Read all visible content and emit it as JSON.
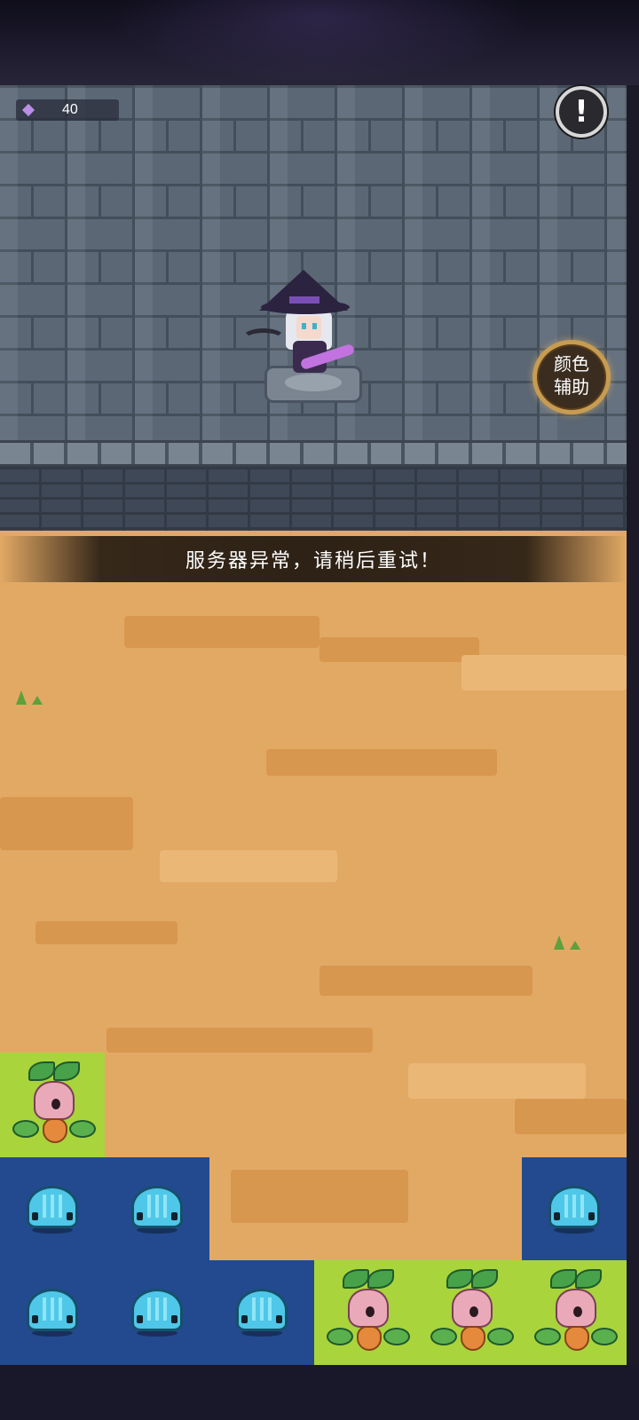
{
  "resources": {
    "gem_count": "40",
    "gem_icon": "purple-crystal-icon"
  },
  "buttons": {
    "info_icon": "!",
    "color_assist_line1": "颜色",
    "color_assist_line2": "辅助"
  },
  "banner": {
    "message": "服务器异常，请稍后重试！"
  },
  "board": {
    "tiles": [
      {
        "row": 0,
        "col": 0,
        "type": "sprout",
        "color": "green"
      },
      {
        "row": 1,
        "col": 0,
        "type": "slime",
        "color": "blue"
      },
      {
        "row": 1,
        "col": 1,
        "type": "slime",
        "color": "blue"
      },
      {
        "row": 1,
        "col": 5,
        "type": "slime",
        "color": "blue"
      },
      {
        "row": 2,
        "col": 0,
        "type": "slime",
        "color": "blue"
      },
      {
        "row": 2,
        "col": 1,
        "type": "slime",
        "color": "blue"
      },
      {
        "row": 2,
        "col": 2,
        "type": "slime",
        "color": "blue"
      },
      {
        "row": 2,
        "col": 3,
        "type": "sprout",
        "color": "green"
      },
      {
        "row": 2,
        "col": 4,
        "type": "sprout",
        "color": "green"
      },
      {
        "row": 2,
        "col": 5,
        "type": "sprout",
        "color": "green"
      }
    ]
  },
  "colors": {
    "blue_tile": "#234a8e",
    "green_tile": "#a9d43c",
    "sand": "#e2a965"
  }
}
